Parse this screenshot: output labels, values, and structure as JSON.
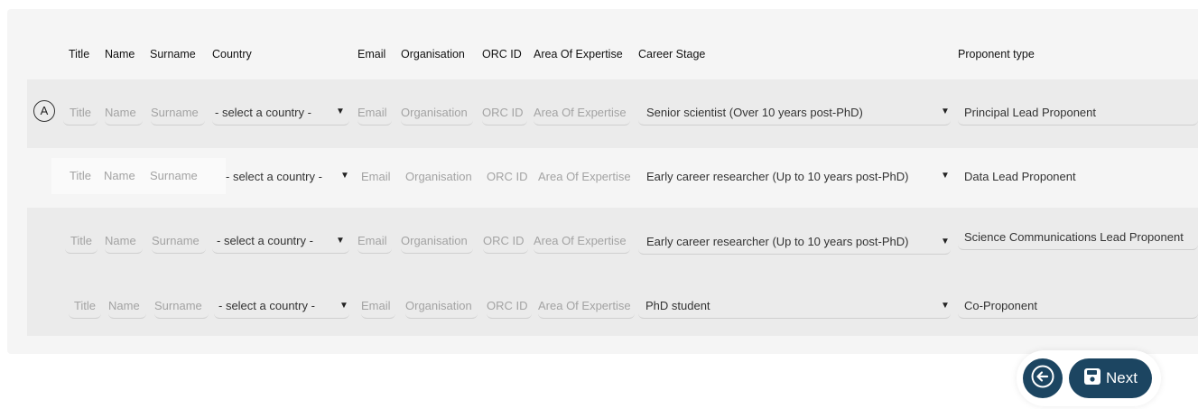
{
  "headers": [
    "Title",
    "Name",
    "Surname",
    "Country",
    "Email",
    "Organisation",
    "ORC ID",
    "Area Of Expertise",
    "Career Stage",
    "Proponent type"
  ],
  "badge": "A",
  "rows": [
    {
      "title": "Title",
      "name": "Name",
      "surname": "Surname",
      "country": "- select a country -",
      "email": "Email",
      "organisation": "Organisation",
      "orcid": "ORC ID",
      "expertise": "Area Of Expertise",
      "career_stage": "Senior scientist (Over 10 years post-PhD)",
      "proponent_type": "Principal Lead Proponent"
    },
    {
      "title": "Title",
      "name": "Name",
      "surname": "Surname",
      "country": "- select a country -",
      "email": "Email",
      "organisation": "Organisation",
      "orcid": "ORC ID",
      "expertise": "Area Of Expertise",
      "career_stage": "Early career researcher (Up to 10 years post-PhD)",
      "proponent_type": "Data Lead Proponent"
    },
    {
      "title": "Title",
      "name": "Name",
      "surname": "Surname",
      "country": "- select a country -",
      "email": "Email",
      "organisation": "Organisation",
      "orcid": "ORC ID",
      "expertise": "Area Of Expertise",
      "career_stage": "Early career researcher (Up to 10 years post-PhD)",
      "proponent_type": "Science Communications Lead Proponent"
    },
    {
      "title": "Title",
      "name": "Name",
      "surname": "Surname",
      "country": "- select a country -",
      "email": "Email",
      "organisation": "Organisation",
      "orcid": "ORC ID",
      "expertise": "Area Of Expertise",
      "career_stage": "PhD student",
      "proponent_type": "Co-Proponent"
    }
  ],
  "nav": {
    "back_icon": "arrow-left-icon",
    "next_icon": "save-icon",
    "next_label": "Next"
  },
  "colors": {
    "nav_button": "#1c4561",
    "panel": "#f5f5f5",
    "row_shaded": "#ebebeb"
  }
}
